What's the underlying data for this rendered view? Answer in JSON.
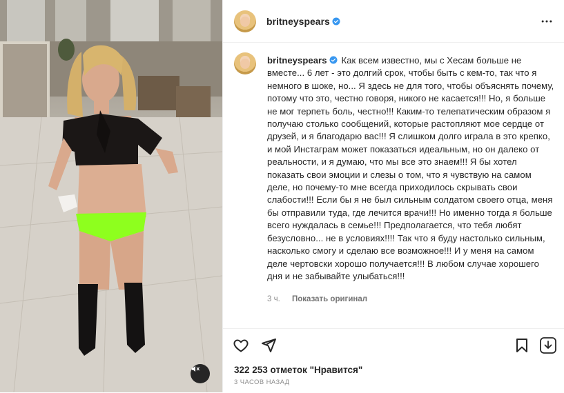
{
  "post": {
    "author": {
      "username": "britneyspears",
      "verified": true
    },
    "caption": {
      "username": "britneyspears",
      "text": "Как всем известно, мы с Хесам больше не вместе... 6 лет - это долгий срок, чтобы быть с кем-то, так что я немного в шоке, но... Я здесь не для того, чтобы объяснять почему, потому что это, честно говоря, никого не касается!!! Но, я больше не мог терпеть боль, честно!!! Каким-то телепатическим образом я получаю столько сообщений, которые растопляют мое сердце от друзей, и я благодарю вас!!! Я слишком долго играла в это крепко, и мой Инстаграм может показаться идеальным, но он далеко от реальности, и я думаю, что мы все это знаем!!! Я бы хотел показать свои эмоции и слезы о том, что я чувствую на самом деле, но почему-то мне всегда приходилось скрывать свои слабости!!! Если бы я не был сильным солдатом своего отца, меня бы отправили туда, где лечится врачи!!! Но именно тогда я больше всего нуждалась в семье!!! Предполагается, что тебя любят безусловно... не в условиях!!!! Так что я буду настолько сильным, насколько смогу и сделаю все возможное!!! И у меня на самом деле чертовски хорошо получается!!! В любом случае хорошего дня и не забывайте улыбаться!!!",
      "age": "3 ч.",
      "show_original": "Показать оригинал"
    },
    "likes_text": "322 253 отметок \"Нравится\"",
    "time_ago": "3 ЧАСОВ НАЗАД"
  },
  "icons": {
    "like": "heart-icon",
    "share": "send-icon",
    "save": "bookmark-icon",
    "download": "download-icon",
    "more": "more-options-icon",
    "mute": "muted-speaker-icon",
    "verified": "verified-badge-icon"
  },
  "colors": {
    "verified": "#3897f0",
    "text": "#262626",
    "secondary": "#8e8e8e"
  }
}
